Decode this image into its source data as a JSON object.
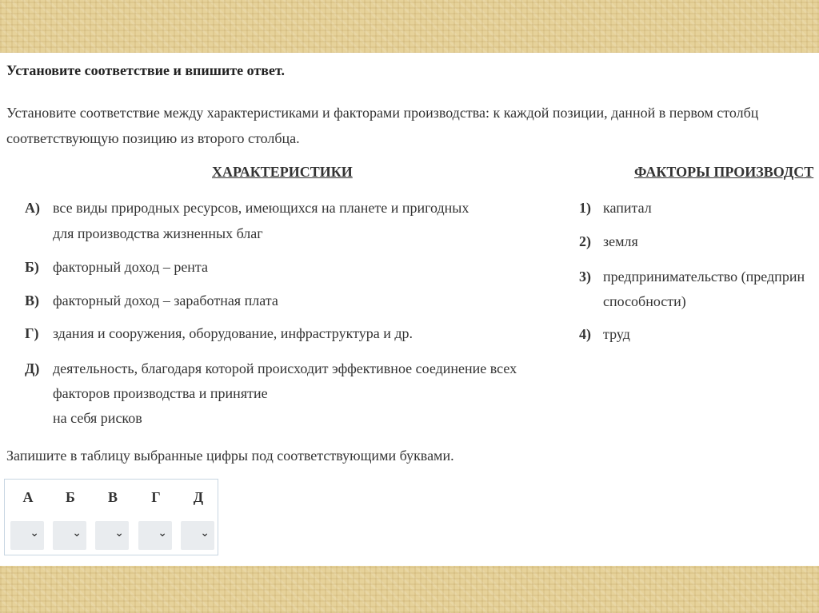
{
  "task": {
    "title": "Установите соответствие и впишите ответ.",
    "intro_line1": "Установите соответствие между характеристиками и факторами производства: к каждой позиции, данной в первом столбц",
    "intro_line2": "соответствующую позицию из второго столбца."
  },
  "left_column": {
    "header": "ХАРАКТЕРИСТИКИ",
    "items": [
      {
        "label": "А)",
        "lines": [
          "все виды природных ресурсов, имеющихся на планете и пригодных",
          "для производства жизненных благ"
        ]
      },
      {
        "label": "Б)",
        "lines": [
          "факторный доход – рента"
        ]
      },
      {
        "label": "В)",
        "lines": [
          "факторный доход – заработная плата"
        ]
      },
      {
        "label": "Г)",
        "lines": [
          "здания и сооружения, оборудование, инфраструктура и др."
        ]
      },
      {
        "label": "Д)",
        "lines": [
          "деятельность, благодаря которой происходит эффективное соединение всех",
          "факторов производства и принятие",
          "на себя рисков"
        ]
      }
    ]
  },
  "right_column": {
    "header": "ФАКТОРЫ ПРОИЗВОДСТ",
    "items": [
      {
        "label": "1)",
        "lines": [
          "капитал"
        ]
      },
      {
        "label": "2)",
        "lines": [
          "земля"
        ]
      },
      {
        "label": "3)",
        "lines": [
          "предпринимательство (предприн",
          "способности)"
        ]
      },
      {
        "label": "4)",
        "lines": [
          "труд"
        ]
      }
    ]
  },
  "instruction": "Запишите в таблицу выбранные цифры под соответствующими буквами.",
  "answer_table": {
    "letters": [
      "А",
      "Б",
      "В",
      "Г",
      "Д"
    ],
    "selects": [
      {
        "value": "",
        "chevron": "chevron-down-icon"
      },
      {
        "value": "",
        "chevron": "chevron-down-icon"
      },
      {
        "value": "",
        "chevron": "chevron-down-icon"
      },
      {
        "value": "",
        "chevron": "chevron-down-icon"
      },
      {
        "value": "",
        "chevron": "chevron-down-icon"
      }
    ]
  },
  "colors": {
    "paper_border": "#e6d29a",
    "sheet": "#ffffff",
    "select_bg": "#e9ecef",
    "table_border": "#c8d6e2"
  }
}
